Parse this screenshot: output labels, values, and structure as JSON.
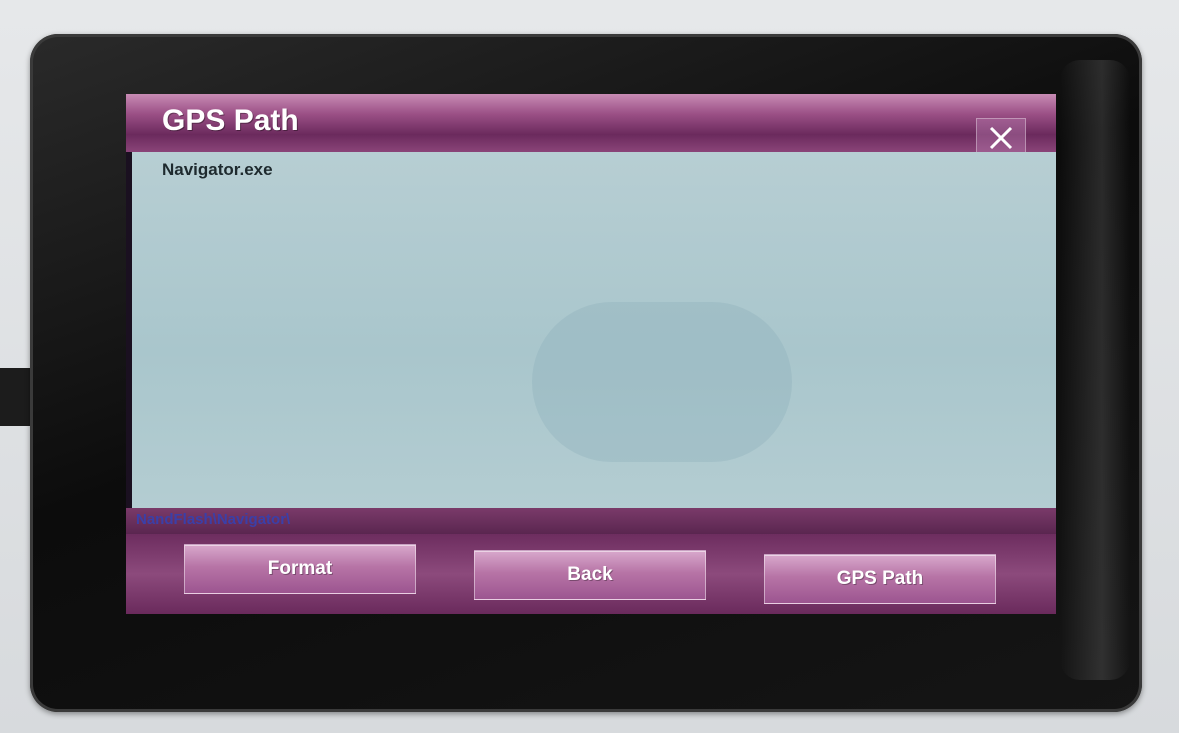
{
  "window": {
    "title": "GPS Path"
  },
  "files": [
    {
      "name": "Navigator.exe"
    }
  ],
  "path": "NandFlash\\Navigator\\",
  "buttons": {
    "format": "Format",
    "back": "Back",
    "gps_path": "GPS Path"
  },
  "icons": {
    "close": "close-icon"
  },
  "colors": {
    "titlebar": "#9a4f85",
    "content_bg": "#b7ced3",
    "path_text": "#3b3fa8"
  }
}
